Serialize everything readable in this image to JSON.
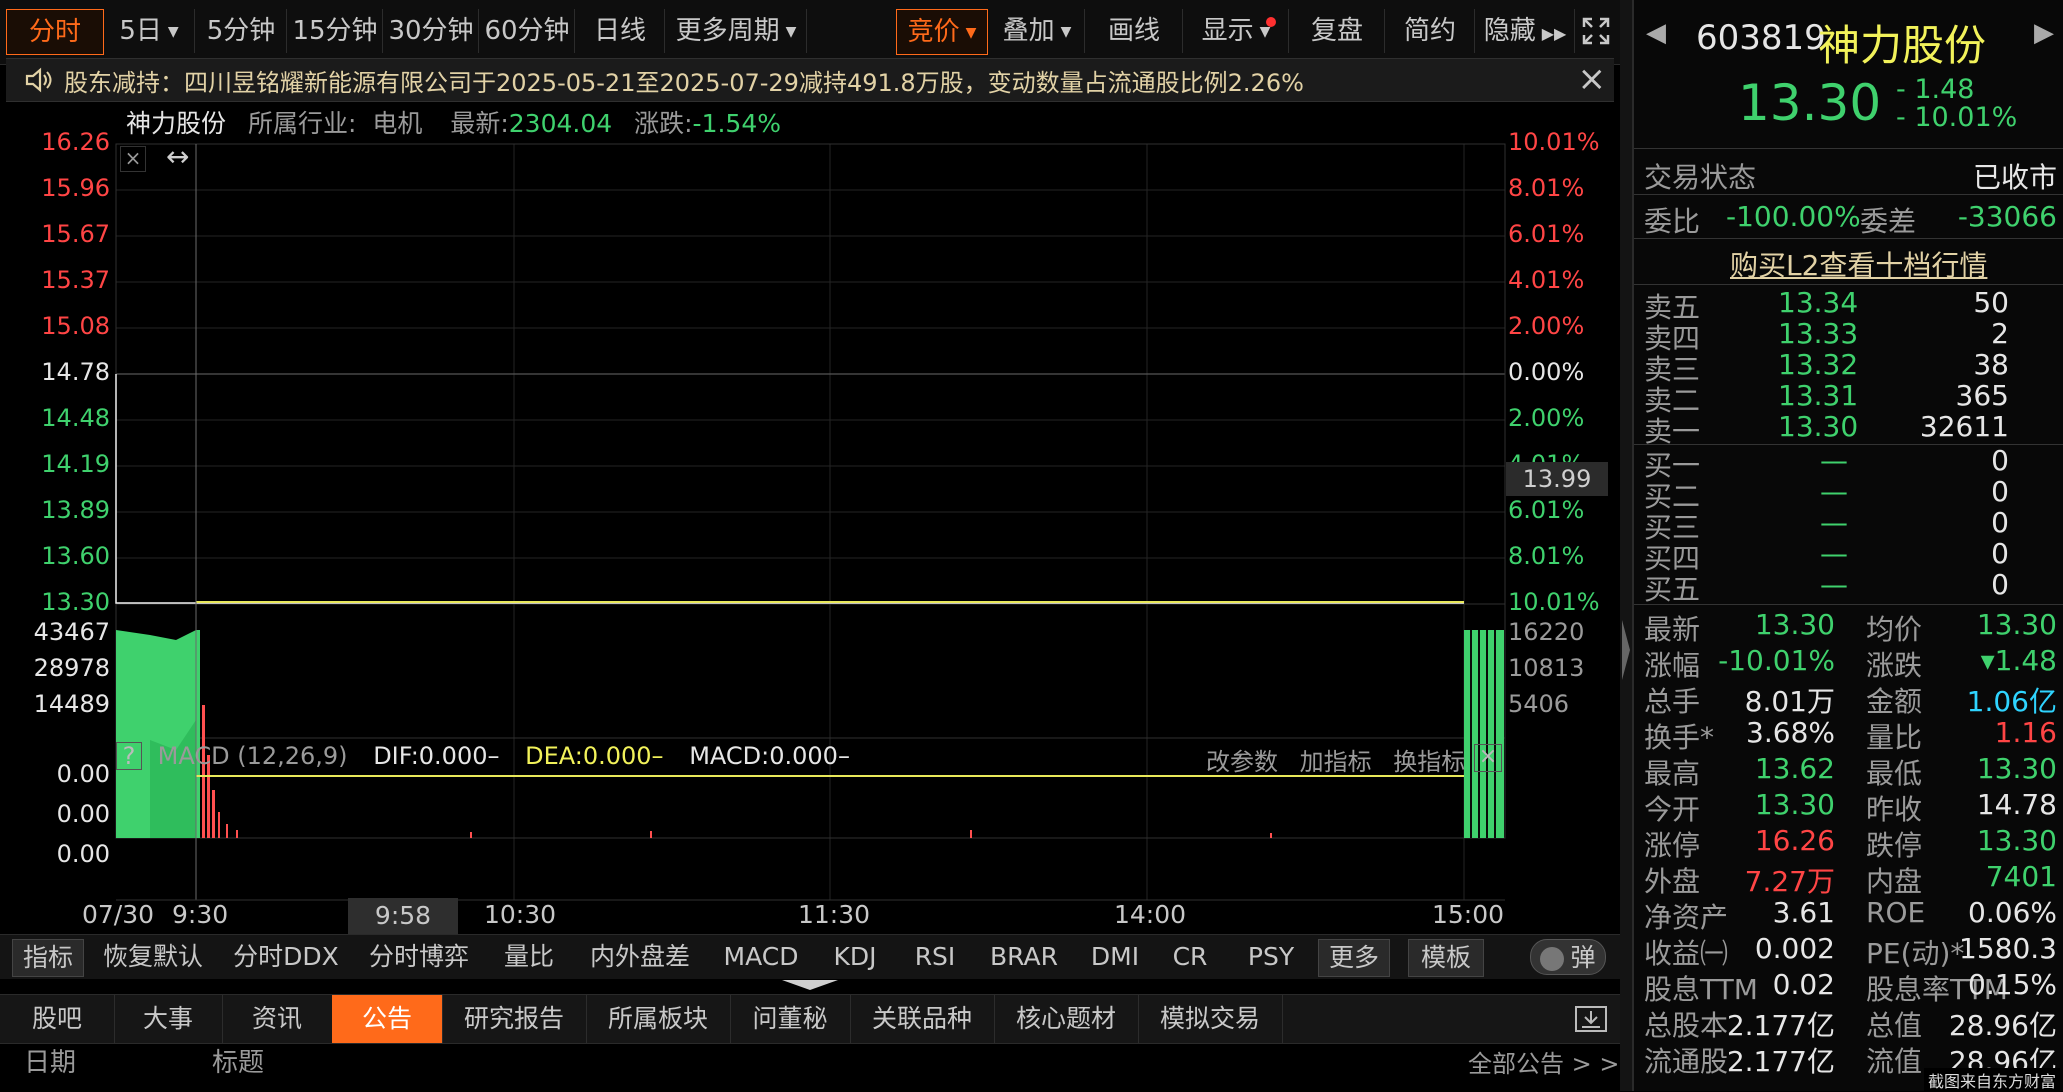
{
  "toolbar": {
    "periods": [
      "分时",
      "5日",
      "5分钟",
      "15分钟",
      "30分钟",
      "60分钟",
      "日线",
      "更多周期"
    ],
    "tools": [
      "竞价",
      "叠加",
      "画线",
      "显示",
      "复盘",
      "简约",
      "隐藏"
    ],
    "fullscreen_icon": "expand-icon"
  },
  "notice": {
    "text": "股东减持：四川昱铭耀新能源有限公司于2025-05-21至2025-07-29减持491.8万股，变动数量占流通股比例2.26%",
    "close": "×"
  },
  "chart_header": {
    "name": "神力股份",
    "industry_label": "所属行业:",
    "industry": "电机",
    "latest_label": "最新:",
    "latest": "2304.04",
    "change_label": "涨跌:",
    "change": "-1.54%"
  },
  "price_axis": {
    "left": [
      "16.26",
      "15.96",
      "15.67",
      "15.37",
      "15.08",
      "14.78",
      "14.48",
      "14.19",
      "13.89",
      "13.60",
      "13.30"
    ],
    "right": [
      "10.01%",
      "8.01%",
      "6.01%",
      "4.01%",
      "2.00%",
      "0.00%",
      "2.00%",
      "4.01%",
      "6.01%",
      "8.01%",
      "10.01%"
    ],
    "crosshair_value": "13.99"
  },
  "volume_axis": {
    "left": [
      "43467",
      "28978",
      "14489"
    ],
    "right": [
      "16220",
      "10813",
      "5406"
    ]
  },
  "macd": {
    "help": "?",
    "title": "MACD (12,26,9)",
    "dif": "DIF:0.000–",
    "dea": "DEA:0.000–",
    "macd": "MACD:0.000–",
    "actions": [
      "改参数",
      "加指标",
      "换指标"
    ],
    "axis": [
      "0.00",
      "0.00",
      "0.00"
    ]
  },
  "time_axis": {
    "date": "07/30",
    "labels": [
      "9:30",
      "10:30",
      "11:30",
      "14:00",
      "15:00"
    ],
    "cursor": "9:58"
  },
  "indicator_tabs": [
    "指标",
    "恢复默认",
    "分时DDX",
    "分时博弈",
    "量比",
    "内外盘差",
    "MACD",
    "KDJ",
    "RSI",
    "BRAR",
    "DMI",
    "CR",
    "PSY",
    "更多",
    "模板"
  ],
  "popup_toggle": "弹",
  "bottom_tabs": [
    "股吧",
    "大事",
    "资讯",
    "公告",
    "研究报告",
    "所属板块",
    "问董秘",
    "关联品种",
    "核心题材",
    "模拟交易"
  ],
  "announcement_header": {
    "date": "日期",
    "title": "标题",
    "all": "全部公告 > >"
  },
  "quote": {
    "code": "603819",
    "name": "神力股份",
    "price": "13.30",
    "change": "- 1.48",
    "change_pct": "- 10.01%",
    "status_label": "交易状态",
    "status": "已收市",
    "weibi_label": "委比",
    "weibi": "-100.00%",
    "weicha_label": "委差",
    "weicha": "-33066",
    "l2_link": "购买L2查看十档行情",
    "asks": [
      {
        "label": "卖五",
        "price": "13.34",
        "vol": "50"
      },
      {
        "label": "卖四",
        "price": "13.33",
        "vol": "2"
      },
      {
        "label": "卖三",
        "price": "13.32",
        "vol": "38"
      },
      {
        "label": "卖二",
        "price": "13.31",
        "vol": "365"
      },
      {
        "label": "卖一",
        "price": "13.30",
        "vol": "32611"
      }
    ],
    "bids": [
      {
        "label": "买一",
        "price": "—",
        "vol": "0"
      },
      {
        "label": "买二",
        "price": "—",
        "vol": "0"
      },
      {
        "label": "买三",
        "price": "—",
        "vol": "0"
      },
      {
        "label": "买四",
        "price": "—",
        "vol": "0"
      },
      {
        "label": "买五",
        "price": "—",
        "vol": "0"
      }
    ],
    "stats": [
      {
        "l1": "最新",
        "v1": "13.30",
        "c1": "green",
        "l2": "均价",
        "v2": "13.30",
        "c2": "green"
      },
      {
        "l1": "涨幅",
        "v1": "-10.01%",
        "c1": "green",
        "l2": "涨跌",
        "v2": "▾1.48",
        "c2": "green"
      },
      {
        "l1": "总手",
        "v1": "8.01万",
        "c1": "white",
        "l2": "金额",
        "v2": "1.06亿",
        "c2": "cyan"
      },
      {
        "l1": "换手*",
        "v1": "3.68%",
        "c1": "white",
        "l2": "量比",
        "v2": "1.16",
        "c2": "red"
      },
      {
        "l1": "最高",
        "v1": "13.62",
        "c1": "green",
        "l2": "最低",
        "v2": "13.30",
        "c2": "green"
      },
      {
        "l1": "今开",
        "v1": "13.30",
        "c1": "green",
        "l2": "昨收",
        "v2": "14.78",
        "c2": "white"
      },
      {
        "l1": "涨停",
        "v1": "16.26",
        "c1": "red",
        "l2": "跌停",
        "v2": "13.30",
        "c2": "green"
      },
      {
        "l1": "外盘",
        "v1": "7.27万",
        "c1": "red",
        "l2": "内盘",
        "v2": "7401",
        "c2": "green"
      },
      {
        "l1": "净资产",
        "v1": "3.61",
        "c1": "white",
        "l2": "ROE",
        "v2": "0.06%",
        "c2": "white"
      },
      {
        "l1": "收益㈠",
        "v1": "0.002",
        "c1": "white",
        "l2": "PE(动)*",
        "v2": "1580.3",
        "c2": "white"
      },
      {
        "l1": "股息TTM",
        "v1": "0.02",
        "c1": "white",
        "l2": "股息率TTM",
        "v2": "0.15%",
        "c2": "white"
      },
      {
        "l1": "总股本",
        "v1": "2.177亿",
        "c1": "white",
        "l2": "总值",
        "v2": "28.96亿",
        "c2": "white"
      },
      {
        "l1": "流通股",
        "v1": "2.177亿",
        "c1": "white",
        "l2": "流值",
        "v2": "28.96亿",
        "c2": "white"
      }
    ]
  },
  "watermark": "截图来自东方财富"
}
